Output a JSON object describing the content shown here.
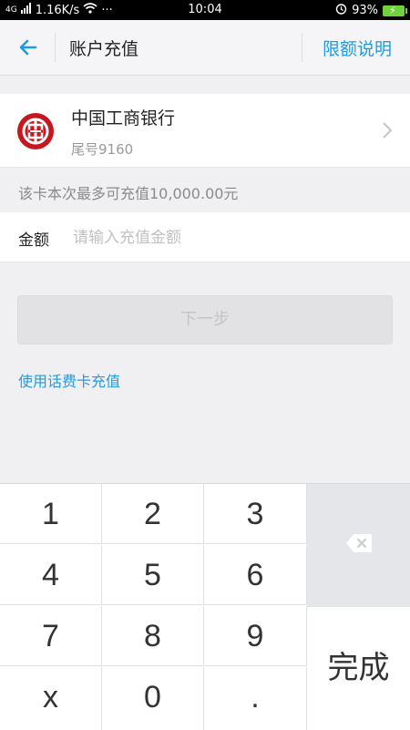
{
  "status_bar": {
    "network": "4G",
    "speed": "1.16K/s",
    "dots": "···",
    "time": "10:04",
    "battery": "93%"
  },
  "nav": {
    "title": "账户充值",
    "limit_link": "限额说明"
  },
  "bank": {
    "name": "中国工商银行",
    "tail": "尾号9160"
  },
  "limit_text": "该卡本次最多可充值10,000.00元",
  "amount": {
    "label": "金额",
    "placeholder": "请输入充值金额",
    "value": ""
  },
  "next_button": "下一步",
  "phonecard_link": "使用话费卡充值",
  "keypad": {
    "keys": [
      "1",
      "2",
      "3",
      "4",
      "5",
      "6",
      "7",
      "8",
      "9",
      "x",
      "0",
      "."
    ],
    "done": "完成"
  },
  "colors": {
    "accent": "#1e9be6",
    "bank_red": "#c8161e",
    "battery_green": "#6fd23a"
  }
}
